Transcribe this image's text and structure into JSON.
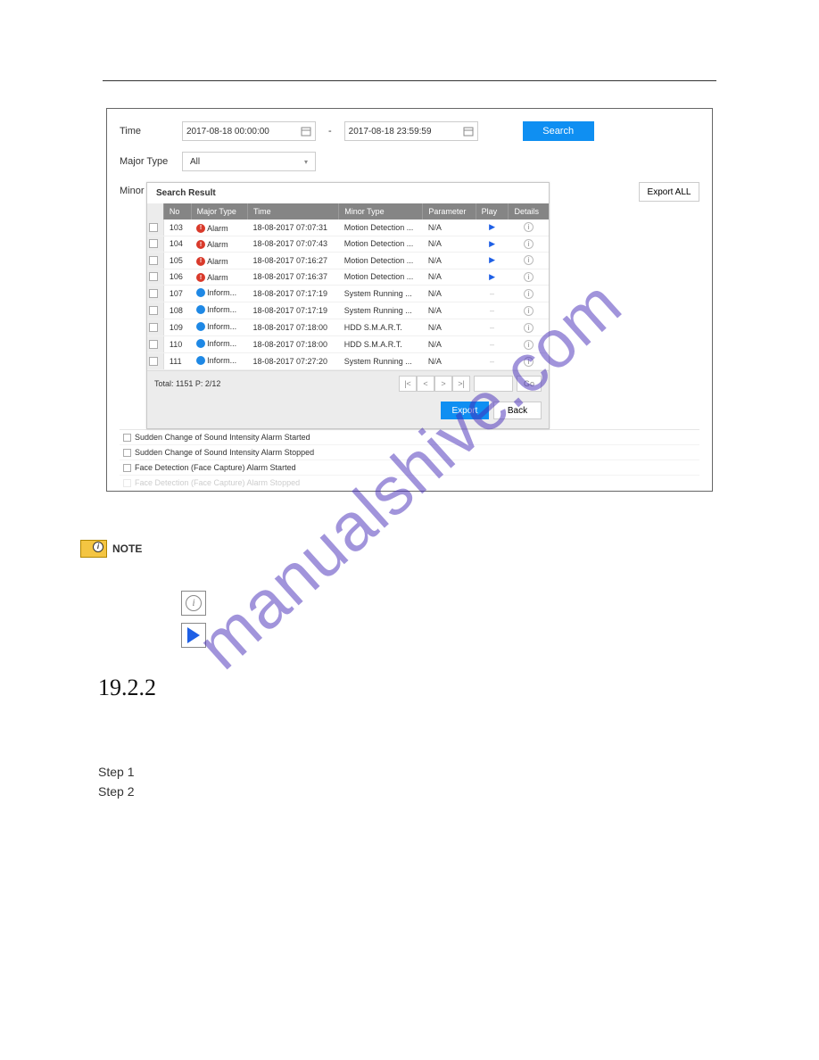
{
  "watermark": "manualshive.com",
  "filter": {
    "time_label": "Time",
    "start": "2017-08-18 00:00:00",
    "end": "2017-08-18 23:59:59",
    "search_btn": "Search",
    "major_type_label": "Major Type",
    "major_type_value": "All",
    "minor_label": "Minor"
  },
  "result": {
    "title": "Search Result",
    "export_all": "Export ALL",
    "headers": {
      "no": "No",
      "major": "Major Type",
      "time": "Time",
      "minor": "Minor Type",
      "param": "Parameter",
      "play": "Play",
      "details": "Details"
    },
    "rows": [
      {
        "no": "103",
        "major": "Alarm",
        "icon": "red",
        "time": "18-08-2017 07:07:31",
        "minor": "Motion Detection ...",
        "param": "N/A",
        "play": true
      },
      {
        "no": "104",
        "major": "Alarm",
        "icon": "red",
        "time": "18-08-2017 07:07:43",
        "minor": "Motion Detection ...",
        "param": "N/A",
        "play": true
      },
      {
        "no": "105",
        "major": "Alarm",
        "icon": "red",
        "time": "18-08-2017 07:16:27",
        "minor": "Motion Detection ...",
        "param": "N/A",
        "play": true
      },
      {
        "no": "106",
        "major": "Alarm",
        "icon": "red",
        "time": "18-08-2017 07:16:37",
        "minor": "Motion Detection ...",
        "param": "N/A",
        "play": true
      },
      {
        "no": "107",
        "major": "Inform...",
        "icon": "blue",
        "time": "18-08-2017 07:17:19",
        "minor": "System Running ...",
        "param": "N/A",
        "play": false
      },
      {
        "no": "108",
        "major": "Inform...",
        "icon": "blue",
        "time": "18-08-2017 07:17:19",
        "minor": "System Running ...",
        "param": "N/A",
        "play": false
      },
      {
        "no": "109",
        "major": "Inform...",
        "icon": "blue",
        "time": "18-08-2017 07:18:00",
        "minor": "HDD S.M.A.R.T.",
        "param": "N/A",
        "play": false
      },
      {
        "no": "110",
        "major": "Inform...",
        "icon": "blue",
        "time": "18-08-2017 07:18:00",
        "minor": "HDD S.M.A.R.T.",
        "param": "N/A",
        "play": false
      },
      {
        "no": "111",
        "major": "Inform...",
        "icon": "blue",
        "time": "18-08-2017 07:27:20",
        "minor": "System Running ...",
        "param": "N/A",
        "play": false
      }
    ],
    "pager_total": "Total: 1151  P: 2/12",
    "go": "Go",
    "export": "Export",
    "back": "Back"
  },
  "below_items": [
    "Sudden Change of Sound Intensity Alarm Started",
    "Sudden Change of Sound Intensity Alarm Stopped",
    "Face Detection (Face Capture) Alarm Started",
    "Face Detection (Face Capture) Alarm Stopped"
  ],
  "note": {
    "label": "NOTE"
  },
  "section": {
    "number": "19.2.2",
    "step1": "Step 1",
    "step2": "Step 2"
  }
}
